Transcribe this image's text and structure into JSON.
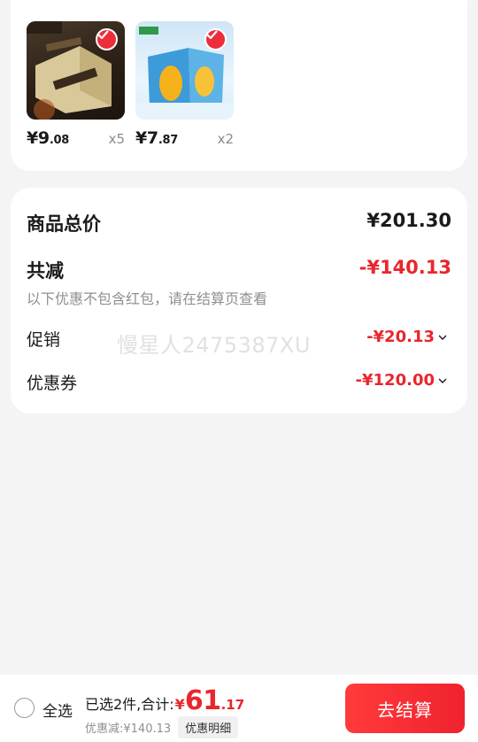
{
  "products": [
    {
      "name": "choco-icecream",
      "price_main": "¥9",
      "price_dec": ".08",
      "qty": "x5"
    },
    {
      "name": "mango-icecream",
      "price_main": "¥7",
      "price_dec": ".87",
      "qty": "x2"
    }
  ],
  "summary": {
    "total_label": "商品总价",
    "total_value": "¥201.30",
    "reduce_label": "共减",
    "reduce_value": "-¥140.13",
    "note": "以下优惠不包含红包，请在结算页查看",
    "promo_label": "促销",
    "promo_value": "-¥20.13",
    "coupon_label": "优惠券",
    "coupon_value": "-¥120.00",
    "watermark": "慢星人2475387XU"
  },
  "bottom": {
    "select_all": "全选",
    "selected_text": "已选2件,合计:",
    "currency": "¥",
    "total_int": "61",
    "total_dec": ".17",
    "discount_text": "优惠减:¥140.13",
    "detail_label": "优惠明细",
    "checkout_label": "去结算"
  },
  "colors": {
    "accent": "#e8262d",
    "check": "#ec2d3c"
  }
}
